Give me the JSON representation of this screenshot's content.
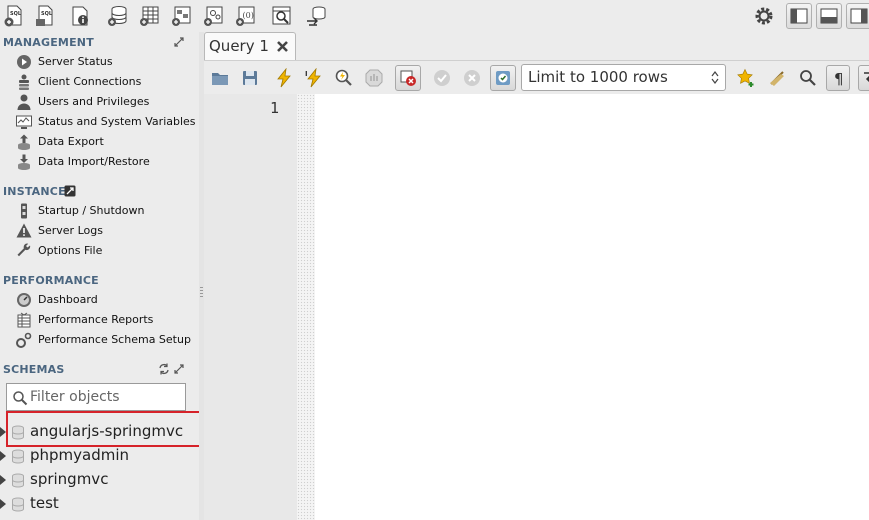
{
  "toolbar": {
    "left_icons": [
      "new-sql-tab-icon",
      "open-sql-script-icon",
      "inspector-icon",
      "create-schema-icon",
      "create-table-icon",
      "create-view-icon",
      "create-procedure-icon",
      "create-function-icon",
      "search-table-data-icon",
      "reconnect-icon"
    ],
    "right_icons": [
      "preferences-gear-icon",
      "toggle-sidebar-icon",
      "toggle-output-icon",
      "toggle-secondary-sidebar-icon"
    ]
  },
  "sidebar": {
    "management": {
      "title": "MANAGEMENT",
      "items": [
        {
          "label": "Server Status",
          "icon": "play-circle-icon"
        },
        {
          "label": "Client Connections",
          "icon": "user-stack-icon"
        },
        {
          "label": "Users and Privileges",
          "icon": "user-icon"
        },
        {
          "label": "Status and System Variables",
          "icon": "monitor-icon"
        },
        {
          "label": "Data Export",
          "icon": "upload-icon"
        },
        {
          "label": "Data Import/Restore",
          "icon": "download-icon"
        }
      ]
    },
    "instance": {
      "title": "INSTANCE",
      "items": [
        {
          "label": "Startup / Shutdown",
          "icon": "power-icon"
        },
        {
          "label": "Server Logs",
          "icon": "warning-icon"
        },
        {
          "label": "Options File",
          "icon": "wrench-icon"
        }
      ]
    },
    "performance": {
      "title": "PERFORMANCE",
      "items": [
        {
          "label": "Dashboard",
          "icon": "dashboard-icon"
        },
        {
          "label": "Performance Reports",
          "icon": "report-icon"
        },
        {
          "label": "Performance Schema Setup",
          "icon": "setup-icon"
        }
      ]
    },
    "schemas": {
      "title": "SCHEMAS",
      "filter_placeholder": "Filter objects",
      "items": [
        {
          "name": "angularjs-springmvc",
          "highlighted": true
        },
        {
          "name": "phpmyadmin"
        },
        {
          "name": "springmvc"
        },
        {
          "name": "test"
        }
      ]
    }
  },
  "query": {
    "tab_label": "Query 1",
    "limit_select": "Limit to 1000 rows",
    "line_number": "1"
  },
  "colors": {
    "section_title": "#4b6680",
    "highlight": "#d6232a",
    "background": "#ececec"
  }
}
